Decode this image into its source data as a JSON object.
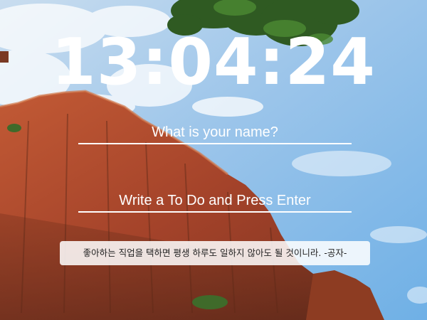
{
  "clock": {
    "time": "13:04:24"
  },
  "name_form": {
    "placeholder": "What is your name?"
  },
  "todo_form": {
    "placeholder": "Write a To Do and Press Enter"
  },
  "quote": {
    "text": "좋아하는 직업을 택하면 평생 하루도 일하지 않아도 될 것이니라. -공자-"
  },
  "colors": {
    "sky": "#8cbfe8",
    "rock": "#a8452a",
    "foliage": "#2f5a22",
    "text": "#ffffff"
  }
}
